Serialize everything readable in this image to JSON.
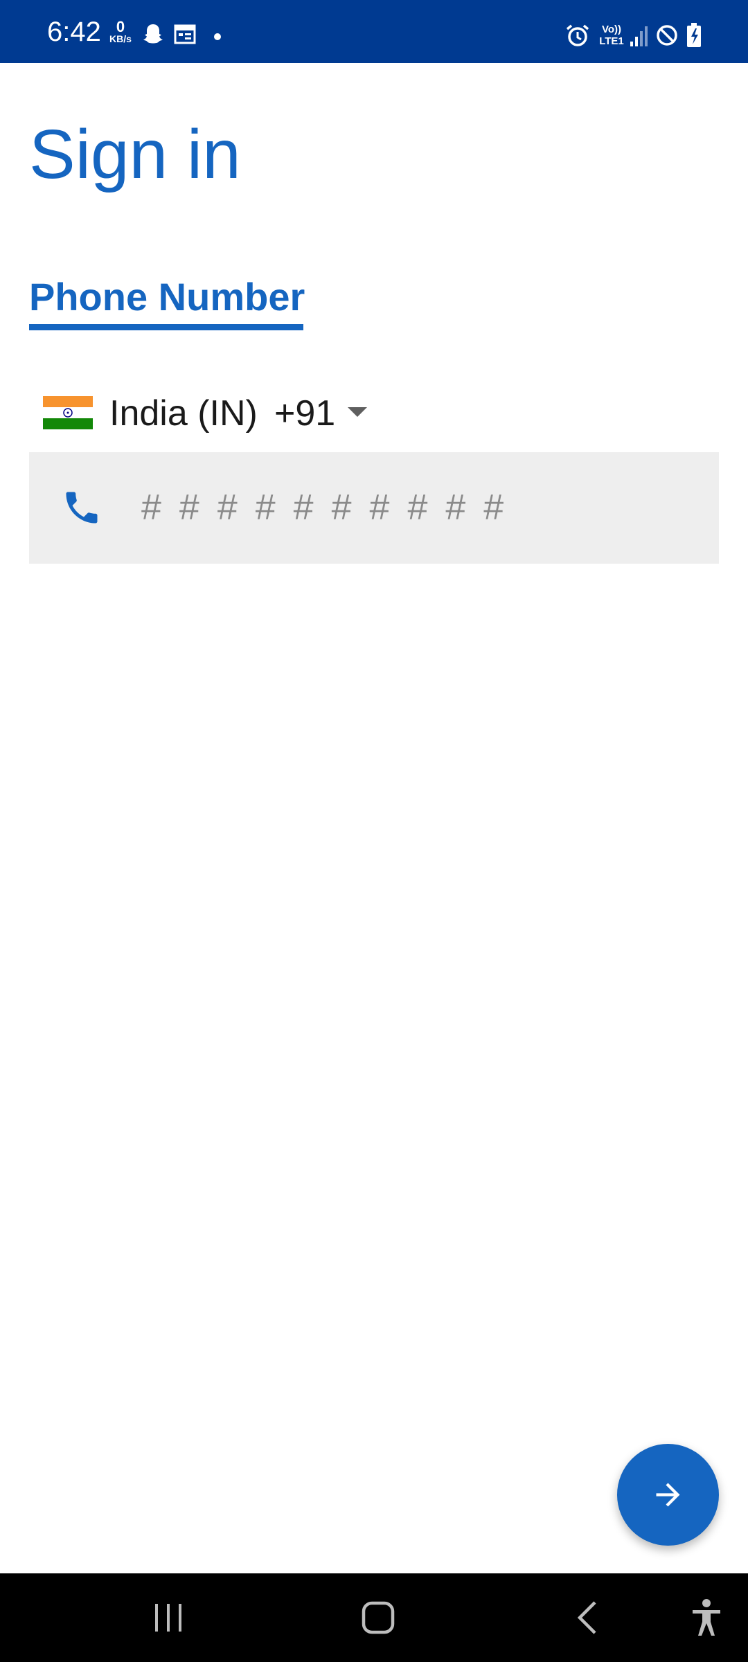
{
  "status_bar": {
    "time": "6:42",
    "net_speed_value": "0",
    "net_speed_unit": "KB/s",
    "network_label_top": "Vo))",
    "network_label_bottom": "LTE1",
    "icons": [
      "snapchat-icon",
      "calendar-icon",
      "dot-icon",
      "alarm-icon",
      "volte-icon",
      "signal-icon",
      "do-not-disturb-icon",
      "battery-charging-icon"
    ]
  },
  "page": {
    "title": "Sign in"
  },
  "tabs": [
    {
      "label": "Phone Number",
      "active": true
    }
  ],
  "country_picker": {
    "flag": "india-flag-icon",
    "country": "India (IN)",
    "dial_code": "+91"
  },
  "phone_field": {
    "icon": "phone-icon",
    "value": "",
    "placeholder": "##########"
  },
  "fab": {
    "icon": "arrow-right-icon"
  },
  "nav_bar": {
    "icons": [
      "recent-apps-icon",
      "home-icon",
      "back-icon",
      "accessibility-icon"
    ]
  },
  "colors": {
    "status_bar": "#003a91",
    "primary": "#1565c0",
    "input_background": "#eeeeee",
    "placeholder": "#8a8a8a",
    "nav_bar": "#000000"
  }
}
